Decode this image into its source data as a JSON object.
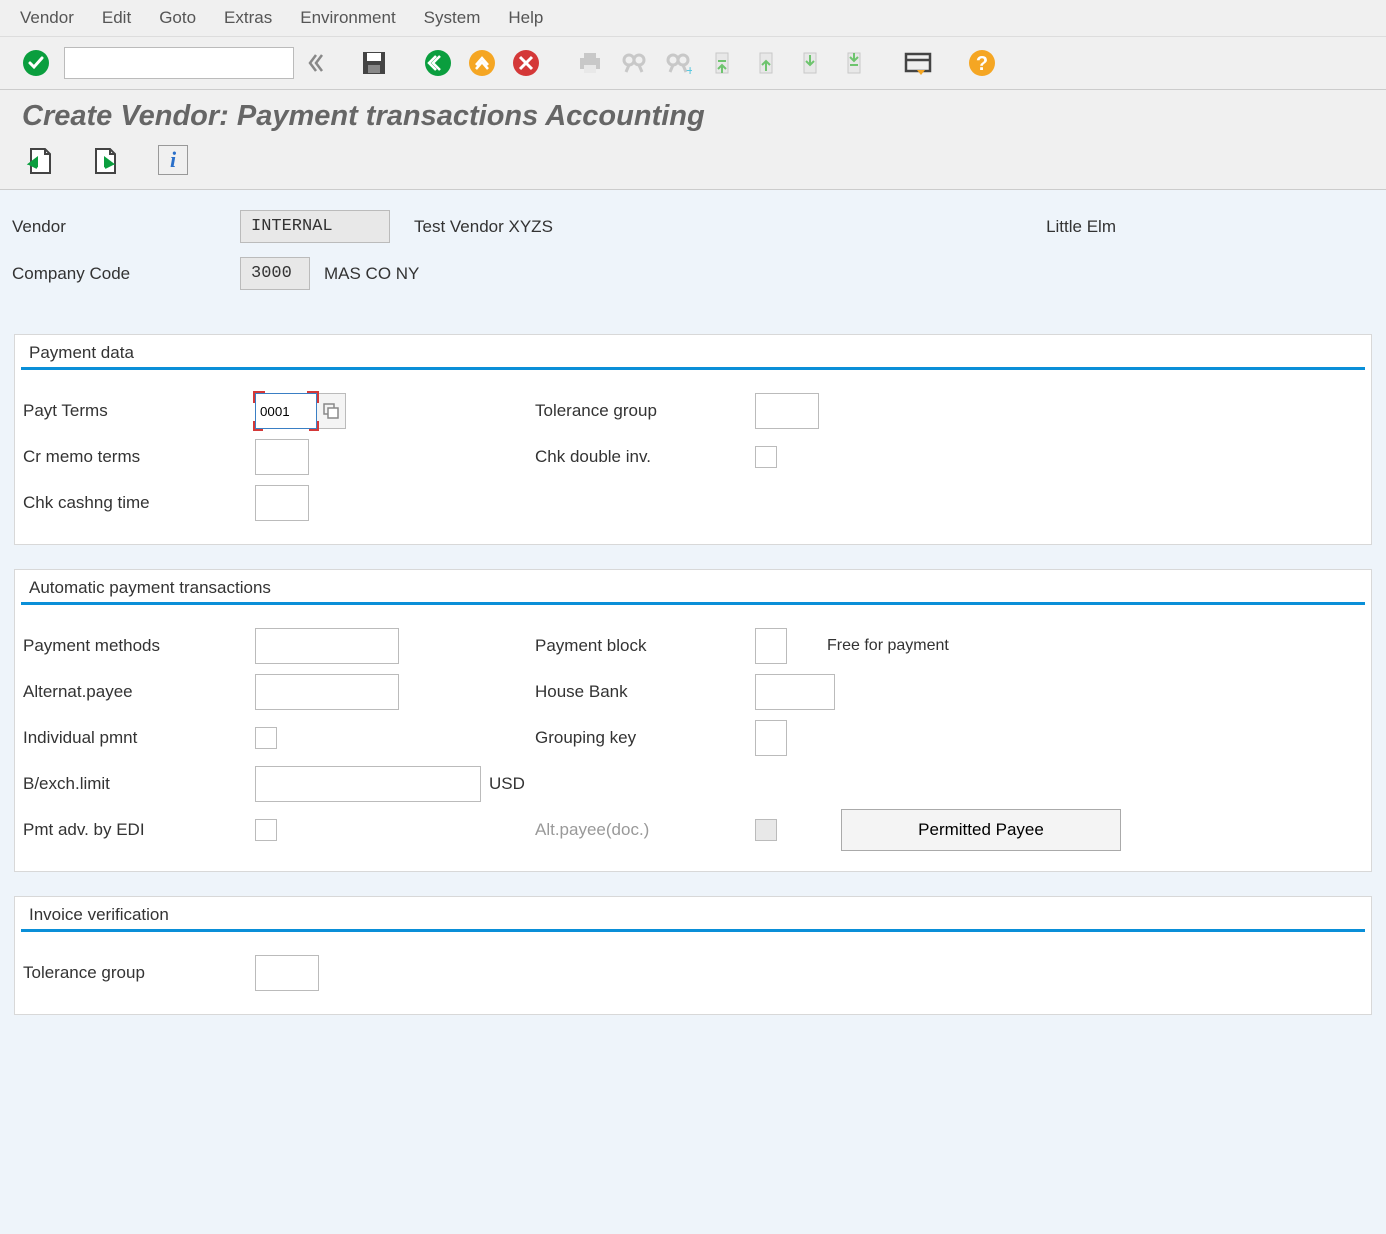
{
  "menu": [
    "Vendor",
    "Edit",
    "Goto",
    "Extras",
    "Environment",
    "System",
    "Help"
  ],
  "page_title": "Create Vendor: Payment transactions Accounting",
  "header": {
    "vendor_label": "Vendor",
    "vendor_value": "INTERNAL",
    "vendor_name": "Test Vendor XYZS",
    "vendor_city": "Little Elm",
    "company_code_label": "Company Code",
    "company_code_value": "3000",
    "company_code_name": "MAS CO NY"
  },
  "payment_data": {
    "title": "Payment data",
    "payt_terms_label": "Payt Terms",
    "payt_terms_value": "0001",
    "cr_memo_label": "Cr memo terms",
    "chk_cashng_label": "Chk cashng time",
    "tolerance_label": "Tolerance group",
    "chk_double_label": "Chk double inv."
  },
  "auto_pay": {
    "title": "Automatic payment transactions",
    "payment_methods_label": "Payment methods",
    "alt_payee_label": "Alternat.payee",
    "individual_pmnt_label": "Individual pmnt",
    "bexch_label": "B/exch.limit",
    "bexch_currency": "USD",
    "pmt_edi_label": "Pmt adv. by EDI",
    "payment_block_label": "Payment block",
    "payment_block_text": "Free for payment",
    "house_bank_label": "House Bank",
    "grouping_key_label": "Grouping key",
    "alt_payee_doc_label": "Alt.payee(doc.)",
    "permitted_payee_btn": "Permitted Payee"
  },
  "invoice_verif": {
    "title": "Invoice verification",
    "tolerance_label": "Tolerance group"
  }
}
